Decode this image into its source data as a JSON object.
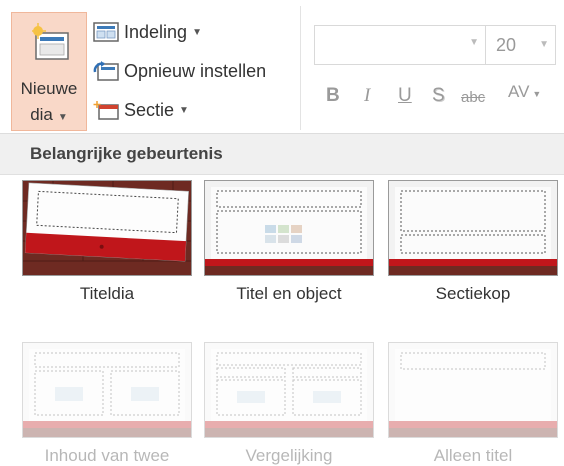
{
  "ribbon": {
    "new_slide": {
      "line1": "Nieuwe",
      "line2": "dia",
      "icon": "new-slide-icon"
    },
    "layout": {
      "label": "Indeling",
      "icon": "layout-icon"
    },
    "reset": {
      "label": "Opnieuw instellen",
      "icon": "reset-icon"
    },
    "section": {
      "label": "Sectie",
      "icon": "section-icon"
    },
    "font_name": "",
    "font_size": "20",
    "format_buttons": [
      "B",
      "I",
      "U",
      "S",
      "abc",
      "AV"
    ]
  },
  "gallery": {
    "header": "Belangrijke gebeurtenis",
    "layouts": [
      {
        "label": "Titeldia"
      },
      {
        "label": "Titel en object"
      },
      {
        "label": "Sectiekop"
      },
      {
        "label": "Inhoud van twee"
      },
      {
        "label": "Vergelijking"
      },
      {
        "label": "Alleen titel"
      }
    ]
  },
  "colors": {
    "accent_red": "#c0161b",
    "brick": "#6e2a22",
    "highlight": "#f9d8c8"
  }
}
